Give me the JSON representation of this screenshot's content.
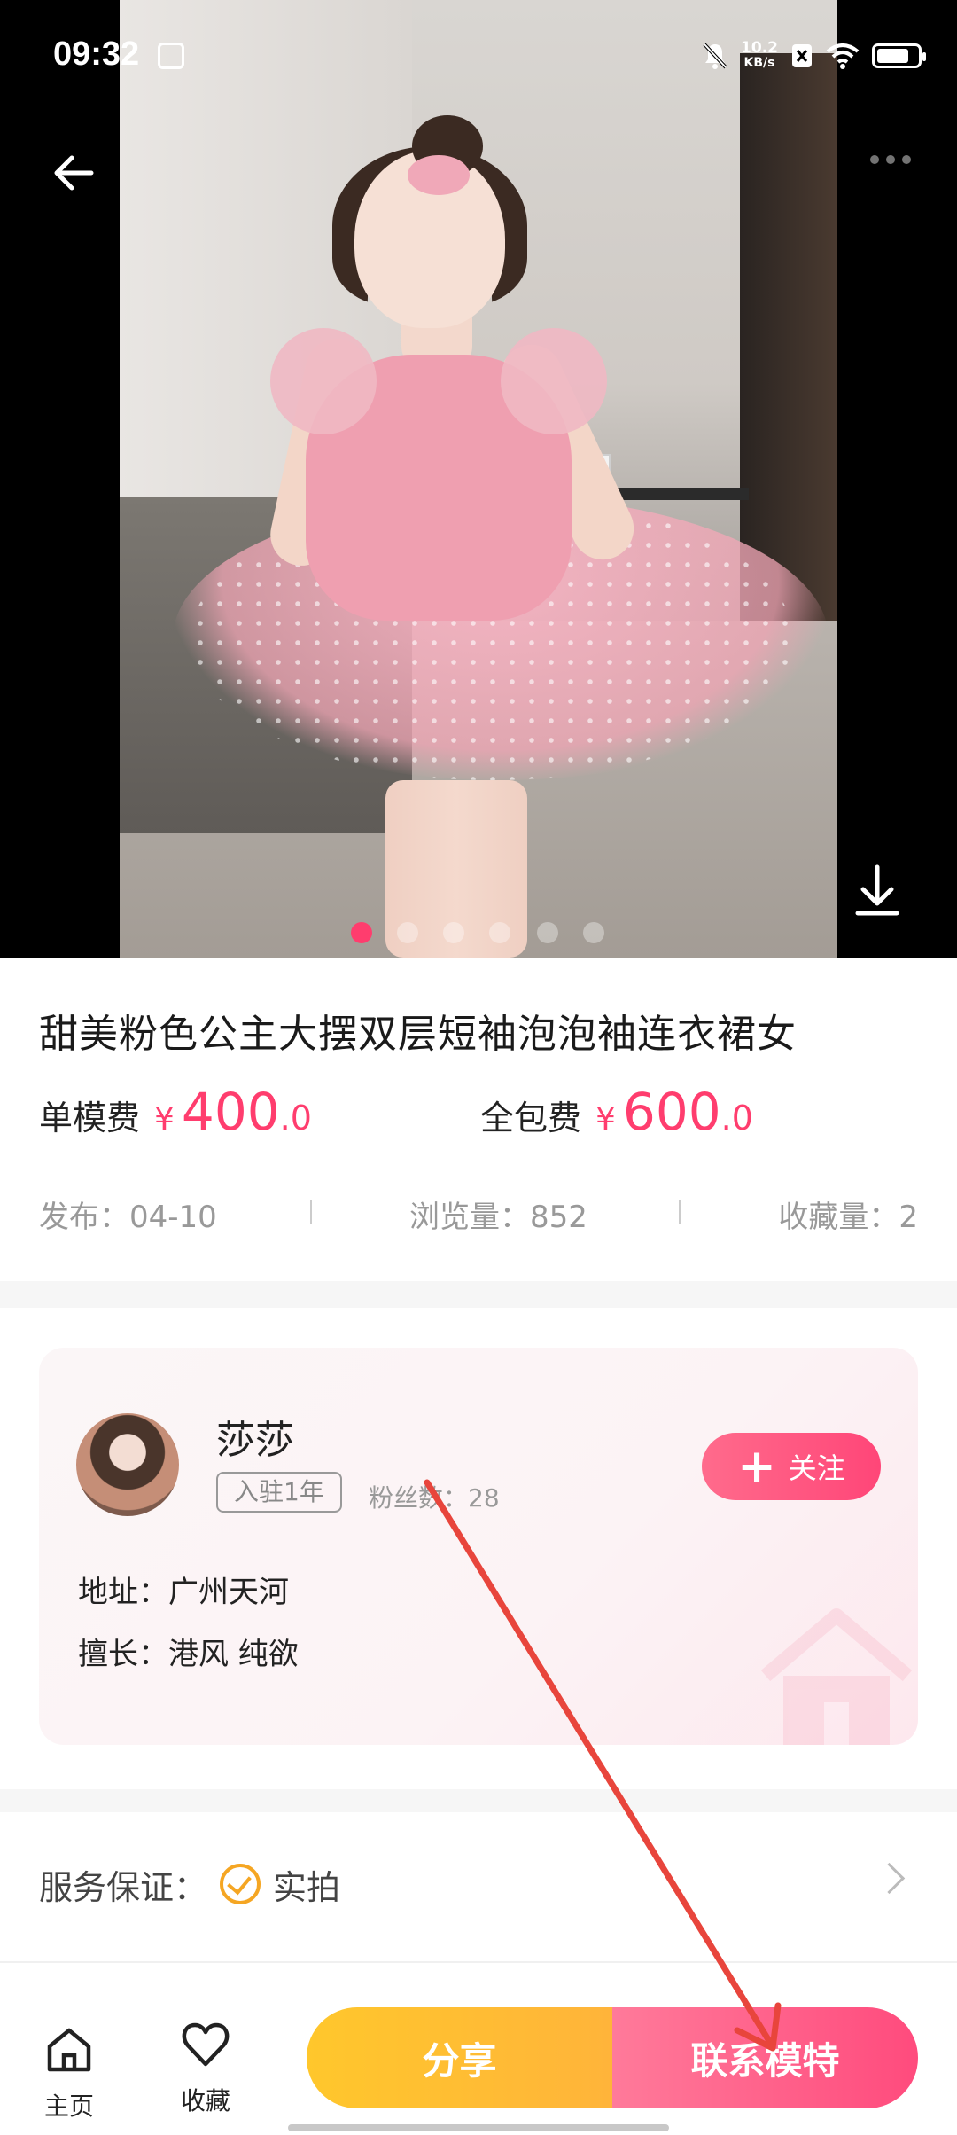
{
  "status_bar": {
    "time": "09:32",
    "net_speed_top": "10.2",
    "net_speed_unit": "KB/s"
  },
  "gallery": {
    "page_count": 6,
    "active_index": 0
  },
  "product": {
    "title": "甜美粉色公主大摆双层短袖泡泡袖连衣裙女",
    "single_fee_label": "单模费",
    "single_fee_currency": "¥",
    "single_fee_int": "400",
    "single_fee_dec": ".0",
    "package_fee_label": "全包费",
    "package_fee_currency": "¥",
    "package_fee_int": "600",
    "package_fee_dec": ".0",
    "published": "发布：04-10",
    "views": "浏览量：852",
    "favorites": "收藏量：2"
  },
  "model": {
    "name": "莎莎",
    "badge": "入驻1年",
    "fans": "粉丝数：28",
    "follow_label": "关注",
    "address": "地址：广州天河",
    "specialty": "擅长：港风 纯欲"
  },
  "service": {
    "label": "服务保证：",
    "item": "实拍"
  },
  "bottom_bar": {
    "home_label": "主页",
    "favorite_label": "收藏",
    "share_label": "分享",
    "contact_label": "联系模特"
  },
  "colors": {
    "accent": "#ff3d6e",
    "share": "#ffc72c",
    "contact": "#ff4b7d",
    "check": "#f5a623"
  }
}
